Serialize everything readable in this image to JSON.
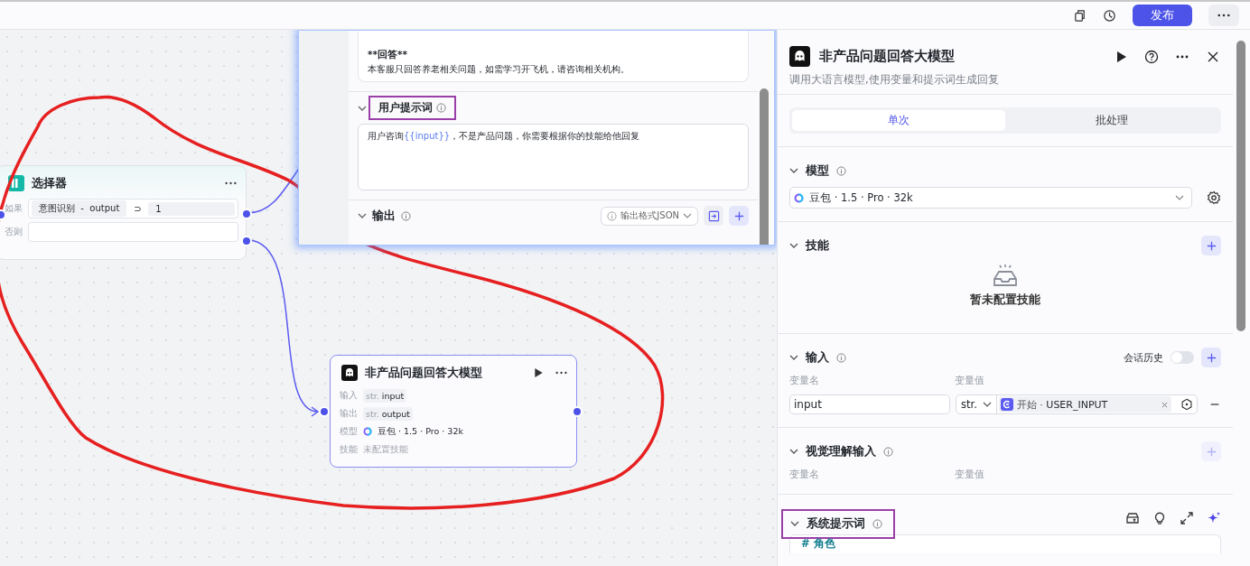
{
  "toolbar": {
    "publish": "发布"
  },
  "selector_node": {
    "title": "选择器",
    "if_label": "如果",
    "condition": {
      "left": "意图识别",
      "sep": "-",
      "field": "output",
      "operator": "⊃",
      "value": "1"
    },
    "else_label": "否则"
  },
  "llm_node": {
    "title": "非产品问题回答大模型",
    "rows": [
      {
        "label": "输入",
        "kind": "var",
        "type": "str.",
        "value": "input"
      },
      {
        "label": "输出",
        "kind": "var",
        "type": "str.",
        "value": "output"
      },
      {
        "label": "模型",
        "kind": "model",
        "value": "豆包 · 1.5 · Pro · 32k"
      },
      {
        "label": "技能",
        "kind": "empty",
        "value": "未配置技能"
      }
    ]
  },
  "prompt_popup": {
    "system_excerpt": [
      "**回答**",
      "本客服只回答养老相关问题，如需学习开飞机，请咨询相关机构。"
    ],
    "user_prompt": {
      "title": "用户提示词",
      "highlighted": true,
      "segments": [
        {
          "kind": "text",
          "text": "用户咨询"
        },
        {
          "kind": "variable",
          "text": "{{input}}"
        },
        {
          "kind": "text",
          "text": "，不是产品问题，你需要根据你的技能给他回复"
        }
      ]
    },
    "output": {
      "title": "输出",
      "format": "输出格式JSON"
    }
  },
  "panel": {
    "title": "非产品问题回答大模型",
    "description": "调用大语言模型,使用变量和提示词生成回复",
    "tabs": [
      {
        "label": "单次",
        "selected": true
      },
      {
        "label": "批处理",
        "selected": false
      }
    ],
    "model": {
      "title": "模型",
      "value": "豆包 · 1.5 · Pro · 32k"
    },
    "skills": {
      "title": "技能",
      "empty": "暂未配置技能"
    },
    "input": {
      "title": "输入",
      "history_label": "会话历史",
      "history_on": false,
      "columns": [
        "变量名",
        "变量值"
      ],
      "rows": [
        {
          "name": "input",
          "type": "str.",
          "source": "开始",
          "sep": "·",
          "variable": "USER_INPUT"
        }
      ]
    },
    "vision_input": {
      "title": "视觉理解输入",
      "columns": [
        "变量名",
        "变量值"
      ],
      "add_disabled": true
    },
    "system_prompt": {
      "title": "系统提示词",
      "highlighted": true,
      "content": "# 角色"
    }
  }
}
